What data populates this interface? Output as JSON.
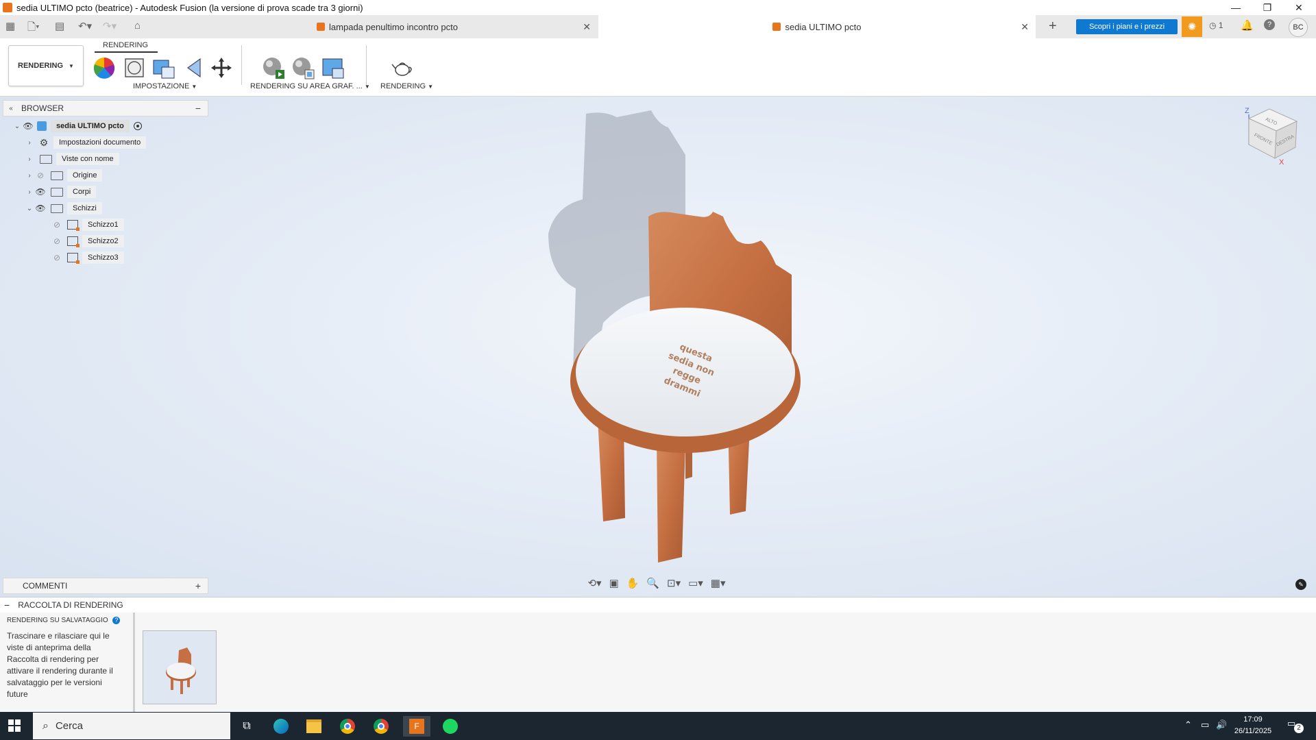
{
  "window": {
    "title": "sedia ULTIMO pcto (beatrice) - Autodesk Fusion (la versione di prova scade tra 3 giorni)",
    "controls": [
      "—",
      "❐",
      "✕"
    ]
  },
  "tabs": [
    {
      "label": "lampada penultimo incontro pcto",
      "active": false
    },
    {
      "label": "sedia ULTIMO pcto",
      "active": true
    }
  ],
  "tabbar": {
    "plans_button": "Scopri i piani e i prezzi",
    "job_count": "1",
    "avatar_initials": "BC"
  },
  "toolbar": {
    "workspace": "RENDERING",
    "active_tab": "RENDERING",
    "groups": {
      "setup": "IMPOSTAZIONE",
      "in_canvas": "RENDERING SU AREA GRAF. ...",
      "render": "RENDERING"
    }
  },
  "browser": {
    "header": "BROWSER",
    "root": "sedia ULTIMO pcto",
    "items": [
      {
        "label": "Impostazioni documento",
        "icon": "gear-icon"
      },
      {
        "label": "Viste con nome",
        "icon": "folder-icon"
      },
      {
        "label": "Origine",
        "icon": "folder-icon",
        "visible": false
      },
      {
        "label": "Corpi",
        "icon": "folder-icon",
        "visible": true
      },
      {
        "label": "Schizzi",
        "icon": "folder-icon",
        "visible": true,
        "expanded": true
      }
    ],
    "sketches": [
      "Schizzo1",
      "Schizzo2",
      "Schizzo3"
    ]
  },
  "comments": {
    "header": "COMMENTI"
  },
  "viewcube": {
    "top": "ALTO",
    "front": "FRONTE",
    "right": "DESTRA",
    "axis_z": "Z",
    "axis_x": "X"
  },
  "model": {
    "engraving": [
      "questa",
      "sedia non",
      "regge",
      "drammi"
    ]
  },
  "gallery": {
    "header": "RACCOLTA DI RENDERING",
    "subheader": "RENDERING SU SALVATAGGIO",
    "description": "Trascinare e rilasciare qui le viste di anteprima della Raccolta di rendering per attivare il rendering durante il salvataggio per le versioni future"
  },
  "taskbar": {
    "search_placeholder": "Cerca",
    "time": "17:09",
    "date": "26/11/2025",
    "notifications": "2"
  },
  "colors": {
    "accent_blue": "#0f79d0",
    "wood": "#c9764a",
    "seat_top": "#f1f3f5",
    "fusion_orange": "#e8741c"
  }
}
